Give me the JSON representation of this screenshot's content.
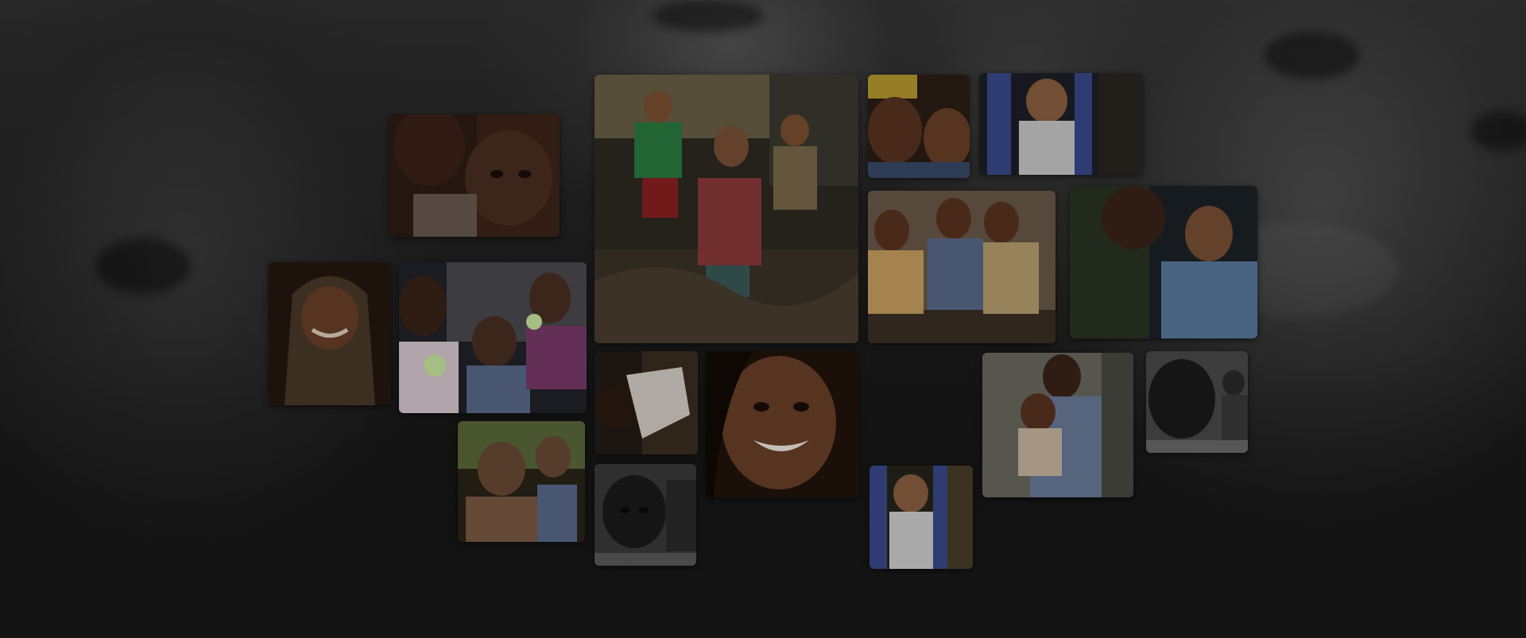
{
  "page": {
    "background_color": "#141414",
    "background_photo": "blurred-smiling-child-face",
    "accent_dark": "#2a2a2a"
  },
  "photos": [
    {
      "id": "two-children-portrait",
      "subject": "two-children",
      "tone": [
        "#5a3a2c",
        "#2e1c14"
      ]
    },
    {
      "id": "children-straw-hut",
      "subject": "children-group-outdoors",
      "tone": [
        "#6a6046",
        "#2c2a20"
      ]
    },
    {
      "id": "girl-yellow-headscarf",
      "subject": "child-portrait",
      "tone": [
        "#6a4a2a",
        "#2a1e14"
      ]
    },
    {
      "id": "toddler-hammock",
      "subject": "toddler",
      "tone": [
        "#4a4a5a",
        "#1e1e28"
      ]
    },
    {
      "id": "woman-headscarf-smiling",
      "subject": "adult-portrait",
      "tone": [
        "#5a3e2c",
        "#24180f"
      ]
    },
    {
      "id": "children-eating-fruit",
      "subject": "children-group",
      "tone": [
        "#5a5a60",
        "#22222a"
      ]
    },
    {
      "id": "three-children-wall",
      "subject": "children-group",
      "tone": [
        "#6a5a48",
        "#2a241c"
      ]
    },
    {
      "id": "boy-blue-shirt",
      "subject": "child-portrait",
      "tone": [
        "#4a5a6a",
        "#1c2228"
      ]
    },
    {
      "id": "man-and-child",
      "subject": "family",
      "tone": [
        "#6a5a3a",
        "#2a2416"
      ]
    },
    {
      "id": "child-sleeping",
      "subject": "child",
      "tone": [
        "#5a4a3a",
        "#221c16"
      ]
    },
    {
      "id": "smiling-girl-closeup",
      "subject": "child-portrait",
      "tone": [
        "#5a3a24",
        "#22140c"
      ]
    },
    {
      "id": "mother-holding-child",
      "subject": "family",
      "tone": [
        "#6a6a60",
        "#2a2a26"
      ]
    },
    {
      "id": "child-bw-portrait",
      "subject": "child-portrait",
      "tone": [
        "#4a4a4a",
        "#1a1a1a"
      ]
    },
    {
      "id": "baby-bw-portrait",
      "subject": "baby-portrait",
      "tone": [
        "#4a4a4a",
        "#1a1a1a"
      ]
    },
    {
      "id": "toddler-hammock-small",
      "subject": "toddler",
      "tone": [
        "#5a5a4a",
        "#24241c"
      ]
    }
  ]
}
